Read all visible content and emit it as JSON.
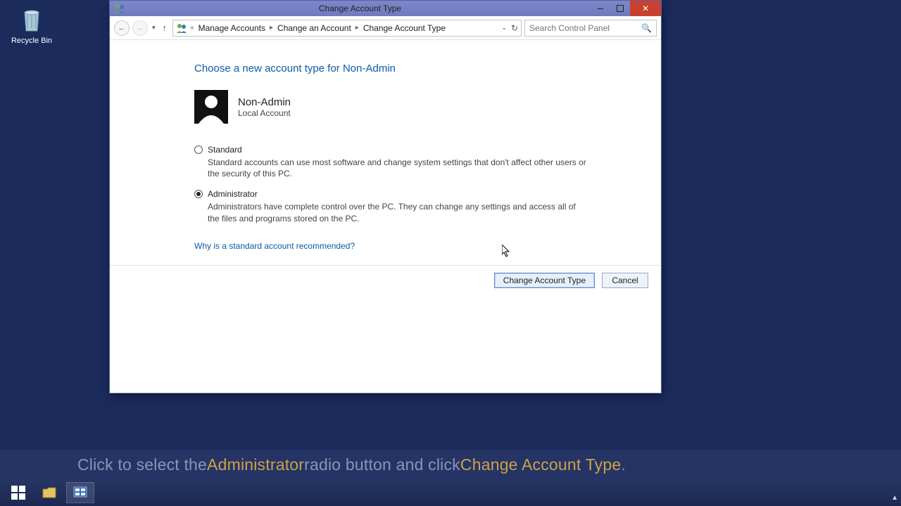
{
  "desktop": {
    "recycle_bin": "Recycle Bin"
  },
  "window": {
    "title": "Change Account Type",
    "breadcrumb": {
      "seg1": "Manage Accounts",
      "seg2": "Change an Account",
      "seg3": "Change Account Type"
    },
    "search_placeholder": "Search Control Panel"
  },
  "page": {
    "heading": "Choose a new account type for Non-Admin",
    "account": {
      "name": "Non-Admin",
      "type": "Local Account"
    },
    "standard": {
      "label": "Standard",
      "desc": "Standard accounts can use most software and change system settings that don't affect other users or the security of this PC."
    },
    "admin": {
      "label": "Administrator",
      "desc": "Administrators have complete control over the PC. They can change any settings and access all of the files and programs stored on the PC."
    },
    "help_link": "Why is a standard account recommended?",
    "change_btn": "Change Account Type",
    "cancel_btn": "Cancel"
  },
  "instruction": {
    "p1": "Click to select the ",
    "h1": "Administrator",
    "p2": " radio button and click ",
    "h2": "Change Account Type",
    "p3": "."
  }
}
